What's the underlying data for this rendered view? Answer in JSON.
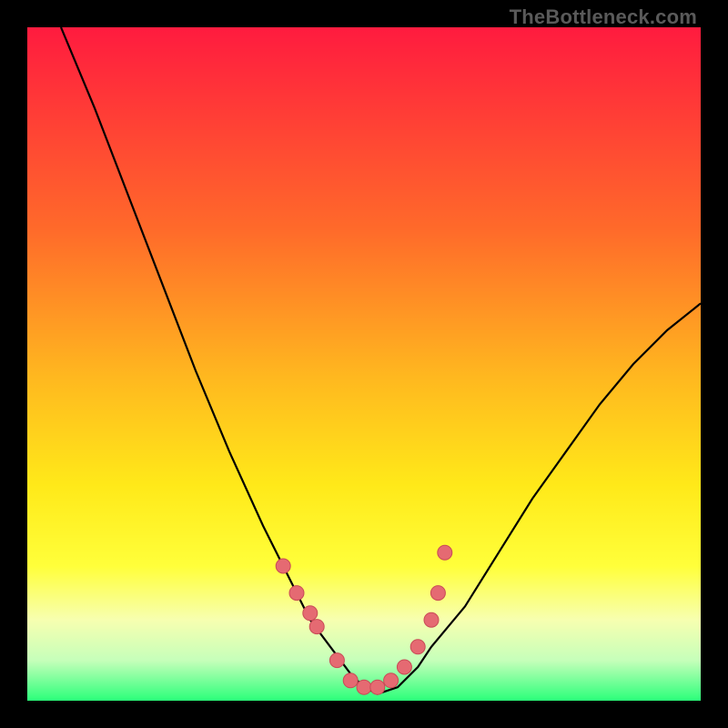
{
  "watermark": "TheBottleneck.com",
  "colors": {
    "top": "#ff1b3f",
    "mid1": "#ff6a2a",
    "mid2": "#ffb81f",
    "mid3": "#ffe919",
    "yellow": "#ffff3a",
    "pale": "#f7ffb0",
    "green_l": "#c6ffba",
    "green": "#2bff7a",
    "curve": "#000000",
    "dot": "#e56a72",
    "dot_stroke": "#c94b56"
  },
  "chart_data": {
    "type": "line",
    "title": "",
    "xlabel": "",
    "ylabel": "",
    "xlim": [
      0,
      100
    ],
    "ylim": [
      0,
      100
    ],
    "grid": false,
    "series": [
      {
        "name": "bottleneck-curve",
        "x": [
          5,
          10,
          15,
          20,
          25,
          30,
          35,
          40,
          42,
          45,
          48,
          50,
          52,
          55,
          58,
          60,
          65,
          70,
          75,
          80,
          85,
          90,
          95,
          100
        ],
        "values": [
          100,
          88,
          75,
          62,
          49,
          37,
          26,
          16,
          12,
          8,
          4,
          2,
          1,
          2,
          5,
          8,
          14,
          22,
          30,
          37,
          44,
          50,
          55,
          59
        ]
      }
    ],
    "dots": {
      "name": "highlighted-points",
      "x": [
        38,
        40,
        42,
        43,
        46,
        48,
        50,
        52,
        54,
        56,
        58,
        60,
        61,
        62
      ],
      "values": [
        20,
        16,
        13,
        11,
        6,
        3,
        2,
        2,
        3,
        5,
        8,
        12,
        16,
        22
      ]
    }
  }
}
